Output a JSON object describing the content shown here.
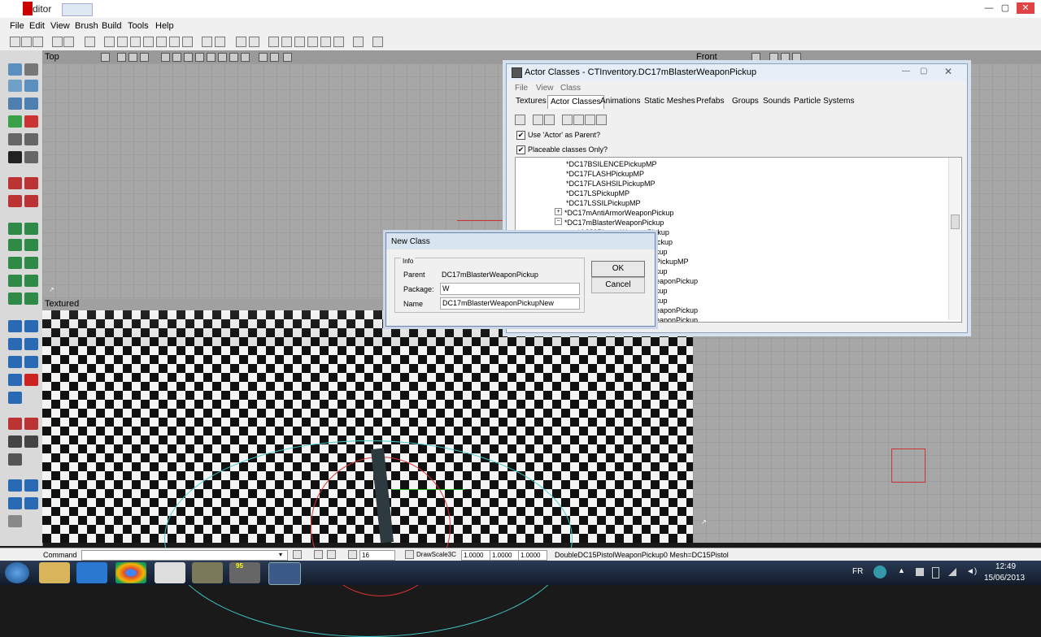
{
  "window": {
    "title": "ditor",
    "minimize": "—",
    "maximize": "▢",
    "close": "✕"
  },
  "menu": [
    "File",
    "Edit",
    "View",
    "Brush",
    "Build",
    "Tools",
    "Help"
  ],
  "viewports": {
    "top": "Top",
    "front": "Front",
    "textured": "Textured"
  },
  "actor_classes": {
    "title": "Actor Classes - CTInventory.DC17mBlasterWeaponPickup",
    "menu": [
      "File",
      "View",
      "Class"
    ],
    "tabs": [
      "Textures",
      "Actor Classes",
      "Animations",
      "Static Meshes",
      "Prefabs",
      "Groups",
      "Sounds",
      "Particle Systems"
    ],
    "use_actor_parent": "Use 'Actor' as Parent?",
    "placeable_only": "Placeable classes Only?",
    "check_mark": "✔",
    "expander_plus": "+",
    "expander_minus": "−",
    "tree": [
      "*DC17BSILENCEPickupMP",
      "*DC17FLASHPickupMP",
      "*DC17FLASHSILPickupMP",
      "*DC17LSPickupMP",
      "*DC17LSSILPickupMP",
      "*DC17mAntiArmorWeaponPickup",
      "*DC17mBlasterWeaponPickup",
      "*A280BlasterWeaponPickup",
      "ickup",
      "kup",
      "PickupMP",
      "kup",
      "eaponPickup",
      "kup",
      "kup",
      "eaponPickup",
      "eaponPickup"
    ]
  },
  "new_class": {
    "title": "New Class",
    "group": "Info",
    "parent_label": "Parent",
    "parent_value": "DC17mBlasterWeaponPickup",
    "package_label": "Package:",
    "package_value": "W",
    "name_label": "Name",
    "name_value": "DC17mBlasterWeaponPickupNew",
    "ok": "OK",
    "cancel": "Cancel"
  },
  "status": {
    "command_label": "Command",
    "grid_value": "16",
    "drawscale_label": "DrawScale3C",
    "scale_x": "1.0000",
    "scale_y": "1.0000",
    "scale_z": "1.0000",
    "selection": "DoubleDC15PistolWeaponPickup0 Mesh=DC15Pistol"
  },
  "taskbar": {
    "lang": "FR",
    "time": "12:49",
    "date": "15/06/2013",
    "badge": "95"
  },
  "colors": {
    "accent_red": "#cc0000",
    "viewport_grey": "#a7a7a7",
    "taskbar": "#1a2536"
  }
}
